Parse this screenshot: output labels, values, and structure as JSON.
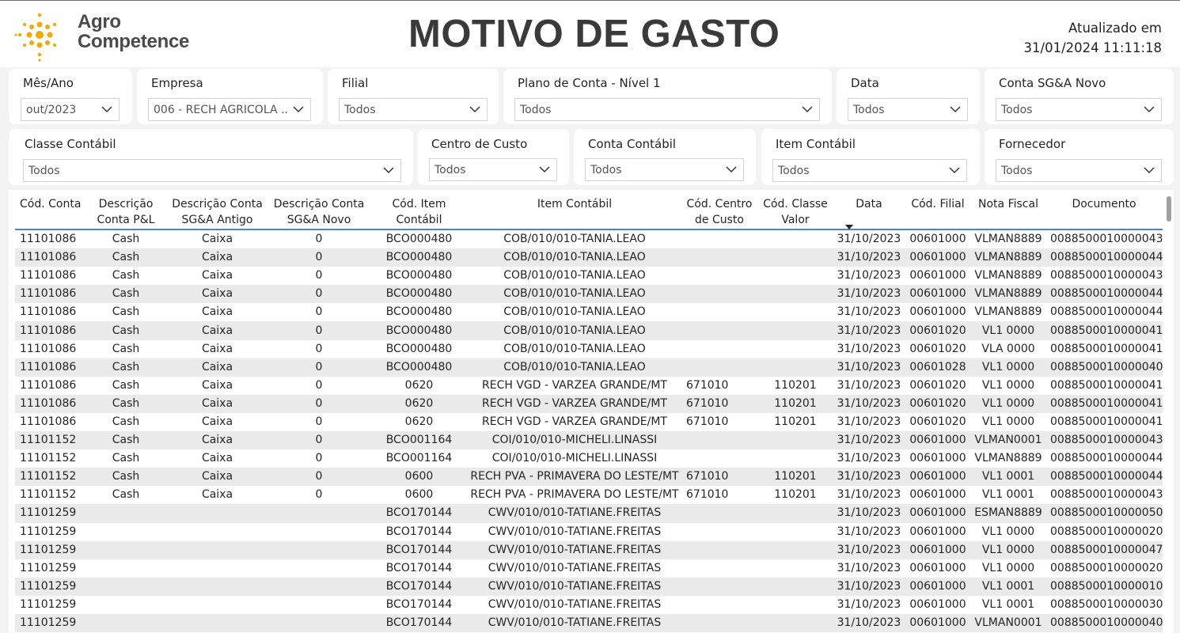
{
  "header": {
    "logo_line1": "Agro",
    "logo_line2": "Competence",
    "title": "MOTIVO DE GASTO",
    "updated_label": "Atualizado em",
    "updated_value": "31/01/2024 11:11:18"
  },
  "slicers": {
    "mes_ano": {
      "label": "Mês/Ano",
      "value": "out/2023"
    },
    "empresa": {
      "label": "Empresa",
      "value": "006 - RECH AGRICOLA ..."
    },
    "filial": {
      "label": "Filial",
      "value": "Todos"
    },
    "plano_conta": {
      "label": "Plano de Conta - Nível 1",
      "value": "Todos"
    },
    "data": {
      "label": "Data",
      "value": "Todos"
    },
    "conta_sga": {
      "label": "Conta SG&A Novo",
      "value": "Todos"
    },
    "classe_contabil": {
      "label": "Classe Contábil",
      "value": "Todos"
    },
    "centro_custo": {
      "label": "Centro de Custo",
      "value": "Todos"
    },
    "conta_contabil": {
      "label": "Conta Contábil",
      "value": "Todos"
    },
    "item_contabil": {
      "label": "Item Contábil",
      "value": "Todos"
    },
    "fornecedor": {
      "label": "Fornecedor",
      "value": "Todos"
    }
  },
  "table": {
    "columns": [
      "Cód. Conta",
      "Descrição Conta P&L",
      "Descrição Conta SG&A Antigo",
      "Descrição Conta SG&A Novo",
      "Cód. Item Contábil",
      "Item Contábil",
      "Cód. Centro de Custo",
      "Cód. Classe Valor",
      "Data",
      "Cód. Filial",
      "Nota Fiscal",
      "Documento"
    ],
    "rows": [
      [
        "11101086",
        "Cash",
        "Caixa",
        "0",
        "BCO000480",
        "COB/010/010-TANIA.LEAO",
        "",
        "",
        "31/10/2023",
        "00601000",
        "VLMAN8889",
        "008850001000004​3"
      ],
      [
        "11101086",
        "Cash",
        "Caixa",
        "0",
        "BCO000480",
        "COB/010/010-TANIA.LEAO",
        "",
        "",
        "31/10/2023",
        "00601000",
        "VLMAN8889",
        "008850001000004​4"
      ],
      [
        "11101086",
        "Cash",
        "Caixa",
        "0",
        "BCO000480",
        "COB/010/010-TANIA.LEAO",
        "",
        "",
        "31/10/2023",
        "00601000",
        "VLMAN8889",
        "008850001000004​3"
      ],
      [
        "11101086",
        "Cash",
        "Caixa",
        "0",
        "BCO000480",
        "COB/010/010-TANIA.LEAO",
        "",
        "",
        "31/10/2023",
        "00601000",
        "VLMAN8889",
        "008850001000004​4"
      ],
      [
        "11101086",
        "Cash",
        "Caixa",
        "0",
        "BCO000480",
        "COB/010/010-TANIA.LEAO",
        "",
        "",
        "31/10/2023",
        "00601000",
        "VLMAN8889",
        "008850001000004​4"
      ],
      [
        "11101086",
        "Cash",
        "Caixa",
        "0",
        "BCO000480",
        "COB/010/010-TANIA.LEAO",
        "",
        "",
        "31/10/2023",
        "00601020",
        "VL1 0000",
        "008850001000004​1"
      ],
      [
        "11101086",
        "Cash",
        "Caixa",
        "0",
        "BCO000480",
        "COB/010/010-TANIA.LEAO",
        "",
        "",
        "31/10/2023",
        "00601020",
        "VLA 0000",
        "008850001000004​1"
      ],
      [
        "11101086",
        "Cash",
        "Caixa",
        "0",
        "BCO000480",
        "COB/010/010-TANIA.LEAO",
        "",
        "",
        "31/10/2023",
        "00601028",
        "VL1 0000",
        "008850001000004​0"
      ],
      [
        "11101086",
        "Cash",
        "Caixa",
        "0",
        "0620",
        "RECH VGD - VARZEA GRANDE/MT",
        "671010",
        "110201",
        "31/10/2023",
        "00601020",
        "VL1 0000",
        "008850001000004​1"
      ],
      [
        "11101086",
        "Cash",
        "Caixa",
        "0",
        "0620",
        "RECH VGD - VARZEA GRANDE/MT",
        "671010",
        "110201",
        "31/10/2023",
        "00601020",
        "VL1 0000",
        "008850001000004​1"
      ],
      [
        "11101086",
        "Cash",
        "Caixa",
        "0",
        "0620",
        "RECH VGD - VARZEA GRANDE/MT",
        "671010",
        "110201",
        "31/10/2023",
        "00601020",
        "VL1 0000",
        "008850001000004​1"
      ],
      [
        "11101152",
        "Cash",
        "Caixa",
        "0",
        "BCO001164",
        "COI/010/010-MICHELI.LINASSI",
        "",
        "",
        "31/10/2023",
        "00601000",
        "VLMAN0001",
        "008850001000004​3"
      ],
      [
        "11101152",
        "Cash",
        "Caixa",
        "0",
        "BCO001164",
        "COI/010/010-MICHELI.LINASSI",
        "",
        "",
        "31/10/2023",
        "00601000",
        "VLMAN8889",
        "008850001000004​4"
      ],
      [
        "11101152",
        "Cash",
        "Caixa",
        "0",
        "0600",
        "RECH PVA - PRIMAVERA DO LESTE/MT",
        "671010",
        "110201",
        "31/10/2023",
        "00601000",
        "VL1 0001",
        "008850001000004​4"
      ],
      [
        "11101152",
        "Cash",
        "Caixa",
        "0",
        "0600",
        "RECH PVA - PRIMAVERA DO LESTE/MT",
        "671010",
        "110201",
        "31/10/2023",
        "00601000",
        "VL1 0001",
        "008850001000004​3"
      ],
      [
        "11101259",
        "",
        "",
        "",
        "BCO170144",
        "CWV/010/010-TATIANE.FREITAS",
        "",
        "",
        "31/10/2023",
        "00601000",
        "ESMAN8889",
        "008850001000005​0"
      ],
      [
        "11101259",
        "",
        "",
        "",
        "BCO170144",
        "CWV/010/010-TATIANE.FREITAS",
        "",
        "",
        "31/10/2023",
        "00601000",
        "VL1 0000",
        "008850001000002​0"
      ],
      [
        "11101259",
        "",
        "",
        "",
        "BCO170144",
        "CWV/010/010-TATIANE.FREITAS",
        "",
        "",
        "31/10/2023",
        "00601000",
        "VL1 0000",
        "008850001000004​7"
      ],
      [
        "11101259",
        "",
        "",
        "",
        "BCO170144",
        "CWV/010/010-TATIANE.FREITAS",
        "",
        "",
        "31/10/2023",
        "00601000",
        "VL1 0000",
        "008850001000002​0"
      ],
      [
        "11101259",
        "",
        "",
        "",
        "BCO170144",
        "CWV/010/010-TATIANE.FREITAS",
        "",
        "",
        "31/10/2023",
        "00601000",
        "VL1 0001",
        "008850001000001​0"
      ],
      [
        "11101259",
        "",
        "",
        "",
        "BCO170144",
        "CWV/010/010-TATIANE.FREITAS",
        "",
        "",
        "31/10/2023",
        "00601000",
        "VL1 0001",
        "008850001000003​0"
      ],
      [
        "11101259",
        "",
        "",
        "",
        "BCO170144",
        "CWV/010/010-TATIANE.FREITAS",
        "",
        "",
        "31/10/2023",
        "00601000",
        "VLMAN0001",
        "008850001000004​0"
      ]
    ]
  },
  "colors": {
    "accent": "#4a86c8",
    "title": "#3a3a3a",
    "logo_dots": "#f2a900",
    "row_alt": "#eaeaea"
  }
}
